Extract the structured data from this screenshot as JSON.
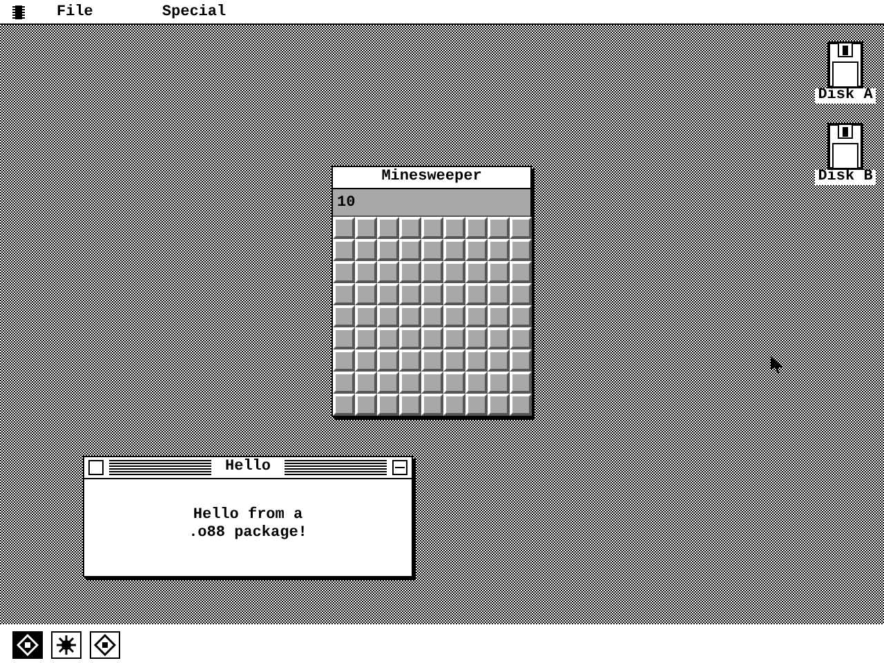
{
  "menu_bar": {
    "items": [
      {
        "label": "File"
      },
      {
        "label": "Special"
      }
    ]
  },
  "desktop_icons": [
    {
      "label": "Disk A"
    },
    {
      "label": "Disk B"
    }
  ],
  "windows": [
    {
      "kind": "game",
      "title": "Minesweeper",
      "active": false,
      "mine_counter": "10",
      "board": [
        [
          {
            "revealed": false
          },
          {
            "revealed": false
          },
          {
            "revealed": false
          },
          {
            "revealed": false
          },
          {
            "revealed": false
          },
          {
            "revealed": false
          },
          {
            "revealed": false
          },
          {
            "revealed": false
          },
          {
            "revealed": false
          }
        ],
        [
          {
            "revealed": false
          },
          {
            "revealed": false
          },
          {
            "revealed": false
          },
          {
            "revealed": false
          },
          {
            "revealed": false
          },
          {
            "revealed": false
          },
          {
            "revealed": false
          },
          {
            "revealed": false
          },
          {
            "revealed": false
          }
        ],
        [
          {
            "revealed": false
          },
          {
            "revealed": false
          },
          {
            "revealed": false
          },
          {
            "revealed": false
          },
          {
            "revealed": false
          },
          {
            "revealed": false
          },
          {
            "revealed": false
          },
          {
            "revealed": false
          },
          {
            "revealed": false
          }
        ],
        [
          {
            "revealed": false
          },
          {
            "revealed": false
          },
          {
            "revealed": false
          },
          {
            "revealed": false
          },
          {
            "revealed": false
          },
          {
            "revealed": false
          },
          {
            "revealed": false
          },
          {
            "revealed": false
          },
          {
            "revealed": false
          }
        ],
        [
          {
            "revealed": false
          },
          {
            "revealed": false
          },
          {
            "revealed": false
          },
          {
            "revealed": false
          },
          {
            "revealed": false
          },
          {
            "revealed": false
          },
          {
            "revealed": false
          },
          {
            "revealed": false
          },
          {
            "revealed": false
          }
        ],
        [
          {
            "revealed": false
          },
          {
            "revealed": false
          },
          {
            "revealed": false
          },
          {
            "revealed": false
          },
          {
            "revealed": false
          },
          {
            "revealed": false
          },
          {
            "revealed": false
          },
          {
            "revealed": false
          },
          {
            "revealed": false
          }
        ],
        [
          {
            "revealed": false
          },
          {
            "revealed": false
          },
          {
            "revealed": false
          },
          {
            "revealed": false
          },
          {
            "revealed": false
          },
          {
            "revealed": false
          },
          {
            "revealed": false
          },
          {
            "revealed": false
          },
          {
            "revealed": false
          }
        ],
        [
          {
            "revealed": false
          },
          {
            "revealed": false
          },
          {
            "revealed": false
          },
          {
            "revealed": false
          },
          {
            "revealed": false
          },
          {
            "revealed": false
          },
          {
            "revealed": false
          },
          {
            "revealed": false
          },
          {
            "revealed": false
          }
        ],
        [
          {
            "revealed": false
          },
          {
            "revealed": false
          },
          {
            "revealed": false
          },
          {
            "revealed": false
          },
          {
            "revealed": false
          },
          {
            "revealed": false
          },
          {
            "revealed": false
          },
          {
            "revealed": false
          },
          {
            "revealed": false
          }
        ]
      ]
    },
    {
      "kind": "message",
      "title": "Hello",
      "active": true,
      "message": [
        "Hello from a",
        ".o88 package!"
      ]
    }
  ],
  "taskbar": [
    {
      "selected": true
    },
    {
      "selected": false
    },
    {
      "selected": false
    }
  ]
}
